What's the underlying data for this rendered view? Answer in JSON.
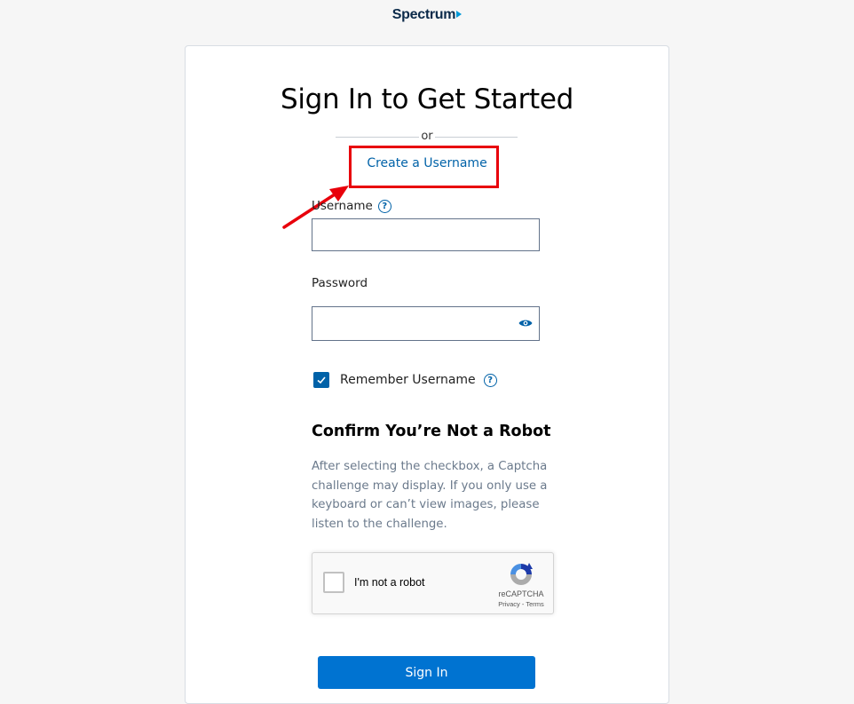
{
  "brand": {
    "logo_text": "Spectrum"
  },
  "card": {
    "title": "Sign In to Get Started",
    "or_text": "or",
    "create_username_link": "Create a Username"
  },
  "form": {
    "username_label": "Username",
    "username_value": "",
    "password_label": "Password",
    "password_value": "",
    "remember_label": "Remember Username",
    "remember_checked": true
  },
  "robot": {
    "title": "Confirm You’re Not a Robot",
    "description": "After selecting the checkbox, a Captcha challenge may display. If you only use a keyboard or can’t view images, please listen to the challenge."
  },
  "recaptcha": {
    "label": "I'm not a robot",
    "brand": "reCAPTCHA",
    "privacy": "Privacy",
    "separator": " - ",
    "terms": "Terms"
  },
  "actions": {
    "signin_label": "Sign In"
  },
  "annotation": {
    "highlight_color": "#e8000b"
  },
  "colors": {
    "accent": "#0062a8",
    "button": "#0073d1"
  }
}
